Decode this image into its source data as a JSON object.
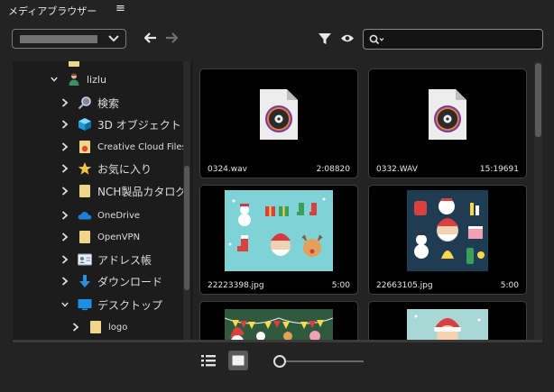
{
  "title": "メディアブラウザー",
  "title_menu_icon": "hamburger-icon",
  "toolbar": {
    "search": {
      "placeholder": "",
      "value": ""
    }
  },
  "tree": [
    {
      "label": "lizlu",
      "icon": "user-icon",
      "expanded": true
    },
    {
      "label": "検索",
      "icon": "search-icon"
    },
    {
      "label": "3D オブジェクト",
      "icon": "cube-icon"
    },
    {
      "label": "Creative Cloud Files",
      "icon": "cc-folder-icon"
    },
    {
      "label": "お気に入り",
      "icon": "star-icon"
    },
    {
      "label": "NCH製品カタログ",
      "icon": "folder-icon"
    },
    {
      "label": "OneDrive",
      "icon": "cloud-icon"
    },
    {
      "label": "OpenVPN",
      "icon": "folder-icon"
    },
    {
      "label": "アドレス帳",
      "icon": "contact-card-icon"
    },
    {
      "label": "ダウンロード",
      "icon": "download-icon"
    },
    {
      "label": "デスクトップ",
      "icon": "desktop-icon",
      "expanded": true
    },
    {
      "label": "logo",
      "icon": "folder-icon"
    }
  ],
  "media": [
    {
      "name": "0324.wav",
      "duration": "2:08820",
      "kind": "audio"
    },
    {
      "name": "0332.WAV",
      "duration": "15:19691",
      "kind": "audio"
    },
    {
      "name": "22223398.jpg",
      "duration": "5:00",
      "kind": "image"
    },
    {
      "name": "22663105.jpg",
      "duration": "5:00",
      "kind": "image"
    }
  ],
  "colors": {
    "background": "#232323",
    "panel": "#1c1c1c",
    "folder": "#f0d68a",
    "onedrive": "#1f7fd6"
  }
}
